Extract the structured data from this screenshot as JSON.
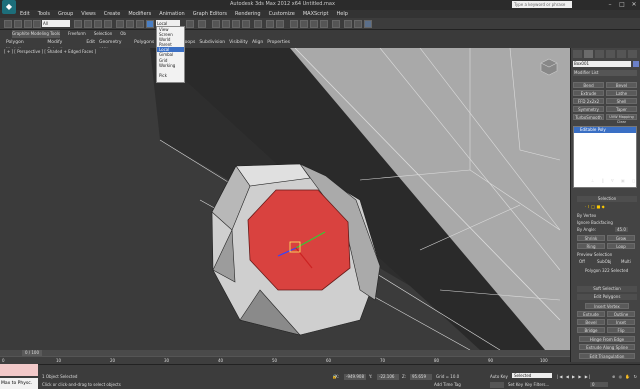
{
  "app": {
    "title": "Autodesk 3ds Max 2012 x64     Untitled.max",
    "search_placeholder": "Type a keyword or phrase"
  },
  "menu": [
    "Edit",
    "Tools",
    "Group",
    "Views",
    "Create",
    "Modifiers",
    "Animation",
    "Graph Editors",
    "Rendering",
    "Customize",
    "MAXScript",
    "Help"
  ],
  "toolbar": {
    "selection_filter": "All",
    "ref_coord": "Local"
  },
  "ref_dropdown": {
    "options": [
      "View",
      "Screen",
      "World",
      "Parent",
      "Local",
      "Gimbal",
      "Grid",
      "Working",
      "",
      "Pick"
    ],
    "selected": "Local"
  },
  "ribbon": {
    "tabs": [
      "Graphite Modeling Tools",
      "Freeform",
      "Selection",
      "Ob"
    ],
    "active_tab": "Graphite Modeling Tools",
    "subtabs": [
      "Polygon Modeling",
      "Modify Selection",
      "Edit",
      "Geometry (All)",
      "Polygons",
      "Loops",
      "Subdivision",
      "Visibility",
      "Align",
      "Properties"
    ]
  },
  "viewport": {
    "label": "[ + ] [ Perspective ] [ Shaded + Edged Faces ]",
    "selection_color": "#d9423f"
  },
  "command_panel": {
    "object_name": "Box001",
    "modifier_list": "Modifier List",
    "modifier_buttons": [
      "Bend",
      "Bevel",
      "Extrude",
      "Lathe",
      "FFD 2x2x2",
      "Shell",
      "Symmetry",
      "Taper",
      "TurboSmooth",
      "UVW Mapping Clear"
    ],
    "stack_item": "Editable Poly",
    "selection_title": "Selection",
    "by_vertex": "By Vertex",
    "ignore_backfacing": "Ignore Backfacing",
    "by_angle": "By Angle:",
    "by_angle_value": "45.0",
    "shrink": "Shrink",
    "grow": "Grow",
    "ring": "Ring",
    "loop": "Loop",
    "preview_selection": "Preview Selection",
    "preview_opts": [
      "Off",
      "SubObj",
      "Multi"
    ],
    "selected_count": "Polygon 322 Selected",
    "soft_selection": "Soft Selection",
    "edit_polygons": "Edit Polygons",
    "insert_vertex": "Insert Vertex",
    "ops": [
      [
        "Extrude",
        "Outline"
      ],
      [
        "Bevel",
        "Inset"
      ],
      [
        "Bridge",
        "Flip"
      ]
    ],
    "hinge": "Hinge From Edge",
    "extrude_spline": "Extrude Along Spline",
    "edit_tri": "Edit Triangulation"
  },
  "timeline": {
    "slider": "0 / 100",
    "ticks": [
      "0",
      "10",
      "20",
      "30",
      "40",
      "50",
      "60",
      "70",
      "80",
      "90",
      "100"
    ]
  },
  "status": {
    "maxscript_label": "Max to Physc.",
    "objects_selected": "1 Object Selected",
    "prompt": "Click or click-and-drag to select objects",
    "x": "-949.908",
    "y": "-22.106",
    "z": "95.659",
    "grid": "Grid = 10.0",
    "add_time_tag": "Add Time Tag",
    "auto_key": "Auto Key",
    "set_key": "Set Key",
    "selected": "Selected",
    "key_filters": "Key Filters...",
    "frame": "0"
  }
}
